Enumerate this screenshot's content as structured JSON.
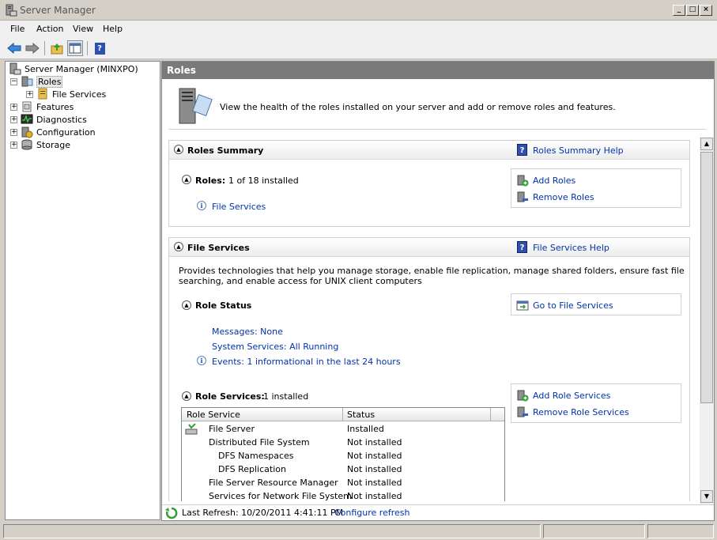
{
  "window": {
    "title": "Server Manager"
  },
  "menu": [
    "File",
    "Action",
    "View",
    "Help"
  ],
  "tree": {
    "root": "Server Manager (MINXPO)",
    "items": [
      {
        "label": "Roles"
      },
      {
        "label": "File Services"
      },
      {
        "label": "Features"
      },
      {
        "label": "Diagnostics"
      },
      {
        "label": "Configuration"
      },
      {
        "label": "Storage"
      }
    ]
  },
  "pane": {
    "header": "Roles",
    "intro": "View the health of the roles installed on your server and add or remove roles and features."
  },
  "roles_summary": {
    "title": "Roles Summary",
    "help": "Roles Summary Help",
    "roles_label": "Roles:",
    "roles_count": "1 of 18 installed",
    "installed_role": "File Services",
    "add_roles": "Add Roles",
    "remove_roles": "Remove Roles"
  },
  "file_services": {
    "title": "File Services",
    "help": "File Services Help",
    "description": "Provides technologies that help you manage storage, enable file replication, manage shared folders, ensure fast file searching, and enable access for UNIX client computers",
    "role_status": "Role Status",
    "goto": "Go to File Services",
    "messages": "Messages: None",
    "system_services": "System Services: All Running",
    "events": "Events: 1 informational in the last 24 hours",
    "role_services_label": "Role Services:",
    "role_services_count": "1 installed",
    "add_role_services": "Add Role Services",
    "remove_role_services": "Remove Role Services",
    "table_headers": [
      "Role Service",
      "Status"
    ],
    "table_rows": [
      {
        "name": "File Server",
        "status": "Installed"
      },
      {
        "name": "Distributed File System",
        "status": "Not installed"
      },
      {
        "name": "DFS Namespaces",
        "status": "Not installed"
      },
      {
        "name": "DFS Replication",
        "status": "Not installed"
      },
      {
        "name": "File Server Resource Manager",
        "status": "Not installed"
      },
      {
        "name": "Services for Network File System",
        "status": "Not installed"
      }
    ]
  },
  "refresh": {
    "text": "Last Refresh: 10/20/2011 4:41:11 PM",
    "configure": "Configure refresh"
  }
}
